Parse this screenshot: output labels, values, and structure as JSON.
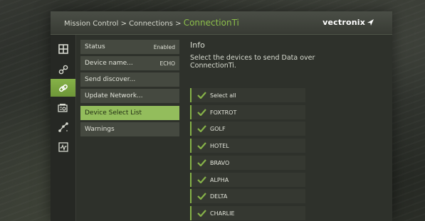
{
  "header": {
    "breadcrumb": {
      "root": "Mission Control",
      "sep1": " > ",
      "parent": "Connections",
      "sep2": " > ",
      "current": "ConnectionTi"
    },
    "brand": "vectronix"
  },
  "rail": {
    "items": [
      {
        "icon": "grid-icon",
        "active": false
      },
      {
        "icon": "nodes-icon",
        "active": false
      },
      {
        "icon": "link-icon",
        "active": true
      },
      {
        "icon": "device-settings-icon",
        "active": false
      },
      {
        "icon": "network-graph-icon",
        "active": false
      },
      {
        "icon": "waveform-icon",
        "active": false
      }
    ]
  },
  "menu": {
    "items": [
      {
        "label": "Status",
        "value": "Enabled",
        "active": false
      },
      {
        "label": "Device name...",
        "value": "ECHO",
        "active": false
      },
      {
        "label": "Send discover...",
        "value": "",
        "active": false
      },
      {
        "label": "Update Network...",
        "value": "",
        "active": false
      },
      {
        "label": "Device Select List",
        "value": "",
        "active": true
      },
      {
        "label": "Warnings",
        "value": "",
        "active": false
      }
    ]
  },
  "info": {
    "title": "Info",
    "description": "Select the devices to send Data over ConnectionTi."
  },
  "devices": {
    "items": [
      {
        "label": "Select all",
        "checked": true
      },
      {
        "label": "FOXTROT",
        "checked": true
      },
      {
        "label": "GOLF",
        "checked": true
      },
      {
        "label": "HOTEL",
        "checked": true
      },
      {
        "label": "BRAVO",
        "checked": true
      },
      {
        "label": "ALPHA",
        "checked": true
      },
      {
        "label": "DELTA",
        "checked": true
      },
      {
        "label": "CHARLIE",
        "checked": true
      }
    ]
  },
  "colors": {
    "accent": "#86b248",
    "active_menu": "#93bd5c",
    "breadcrumb_current": "#8cbf4a",
    "panel": "#2e312b",
    "menu_item": "#454940"
  }
}
